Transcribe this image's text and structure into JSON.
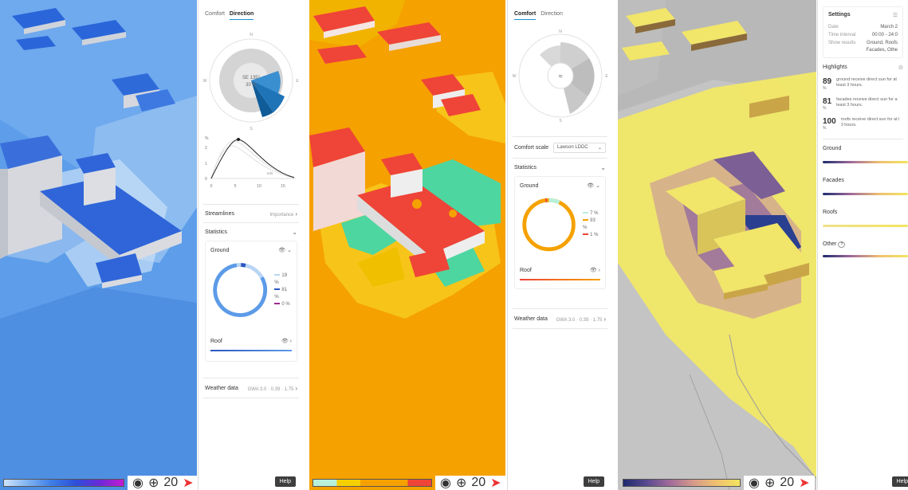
{
  "panel1": {
    "tabs": [
      "Comfort",
      "Direction"
    ],
    "active_tab": "Direction",
    "compass": {
      "n": "N",
      "e": "E",
      "s": "S",
      "w": "W"
    },
    "wind_center_dir": "SE 135°",
    "wind_center_pct": "30 %",
    "chart": {
      "ylabel": "%",
      "yticks": [
        "2",
        "1",
        "0"
      ],
      "xticks": [
        "0",
        "5",
        "10",
        "15"
      ],
      "annotation": "m/s"
    },
    "streamlines_label": "Streamlines",
    "streamlines_value": "Importance",
    "statistics_label": "Statistics",
    "ground_label": "Ground",
    "ground_legend": [
      "19 %",
      "81 %",
      "0 %"
    ],
    "roof_label": "Roof",
    "weather_label": "Weather data",
    "weather_value": "GWA 3.0 · 0.39 · 1.75"
  },
  "panel2": {
    "tabs": [
      "Comfort",
      "Direction"
    ],
    "active_tab": "Comfort",
    "compass": {
      "n": "N",
      "e": "E",
      "s": "S",
      "w": "W"
    },
    "comfort_scale_label": "Comfort scale",
    "comfort_scale_value": "Lawson LDDC",
    "statistics_label": "Statistics",
    "ground_label": "Ground",
    "ground_legend": [
      "7 %",
      "93 %",
      "1 %"
    ],
    "roof_label": "Roof",
    "weather_label": "Weather data",
    "weather_value": "GWA 3.0 · 0.39 · 1.75"
  },
  "panel3": {
    "settings_title": "Settings",
    "date_label": "Date",
    "date_value": "March 2",
    "interval_label": "Time interval",
    "interval_value": "00:00 - 24:0",
    "results_label": "Show results",
    "results_value_1": "Ground, Roofs",
    "results_value_2": "Facades, Othe",
    "highlights_title": "Highlights",
    "highlights": [
      {
        "num": "89",
        "pct": "%",
        "text1": "ground receive direct sun for at",
        "text2": "least 3 hours."
      },
      {
        "num": "81",
        "pct": "%",
        "text1": "facades receive direct sun for a",
        "text2": "least 3 hours."
      },
      {
        "num": "100",
        "pct": "%",
        "text1": "roofs receive direct sun for at l",
        "text2": "3 hours."
      }
    ],
    "ground_label": "Ground",
    "facades_label": "Facades",
    "roofs_label": "Roofs",
    "other_label": "Other"
  },
  "toolbar": {
    "zoom": "20",
    "help_label": "Help"
  },
  "colors": {
    "wind_blue": "#5b9be8",
    "wind_dark": "#1b4fd8",
    "comfort_orange": "#f5a100",
    "comfort_red": "#ef4438",
    "comfort_green": "#4dd6a0",
    "sun_yellow": "#f1e56a",
    "accent": "#1a8fd4"
  }
}
